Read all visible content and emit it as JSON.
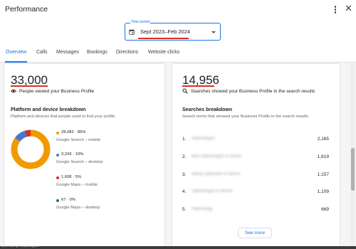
{
  "header": {
    "title": "Performance"
  },
  "period": {
    "label": "Time period",
    "value": "Sept 2023–Feb 2024"
  },
  "tabs": [
    "Overview",
    "Calls",
    "Messages",
    "Bookings",
    "Directions",
    "Website clicks"
  ],
  "active_tab": "Overview",
  "left_card": {
    "total": "33,000",
    "total_label": "People viewed your Business Profile",
    "section_title": "Platform and device breakdown",
    "section_desc": "Platform and devices that people used to find your profile",
    "breakdown": [
      {
        "value": "28,082 · 85%",
        "label": "Google Search – mobile",
        "color": "#f29900",
        "fraction": 0.85
      },
      {
        "value": "3,243 · 10%",
        "label": "Google Search – desktop",
        "color": "#4a78c8",
        "fraction": 0.1
      },
      {
        "value": "1,608 · 5%",
        "label": "Google Maps – mobile",
        "color": "#d93025",
        "fraction": 0.05
      },
      {
        "value": "67 · 0%",
        "label": "Google Maps – desktop",
        "color": "#188038",
        "fraction": 0.0
      }
    ]
  },
  "right_card": {
    "total": "14,956",
    "total_label": "Searches showed your Business Profile in the search results",
    "section_title": "Searches breakdown",
    "section_desc": "Search terms that showed your Business Profile in the search results",
    "searches": [
      {
        "rank": "1.",
        "term": "nephrologist",
        "count": "2,165"
      },
      {
        "rank": "2.",
        "term": "best nephrologist in lahore",
        "count": "1,619"
      },
      {
        "rank": "3.",
        "term": "kidney specialist in lahore",
        "count": "1,157"
      },
      {
        "rank": "4.",
        "term": "nephrologist in lahore",
        "count": "1,109"
      },
      {
        "rank": "5.",
        "term": "nephrology",
        "count": "669"
      }
    ],
    "see_more": "See more"
  },
  "taskbar": {
    "text": "nes – Liberty – Nephrologists"
  },
  "icons": {
    "menu": "more-vert-icon",
    "close": "close-icon",
    "calendar": "calendar-icon",
    "dropdown": "chevron-down-icon",
    "views": "eye-icon",
    "searches": "search-icon"
  }
}
